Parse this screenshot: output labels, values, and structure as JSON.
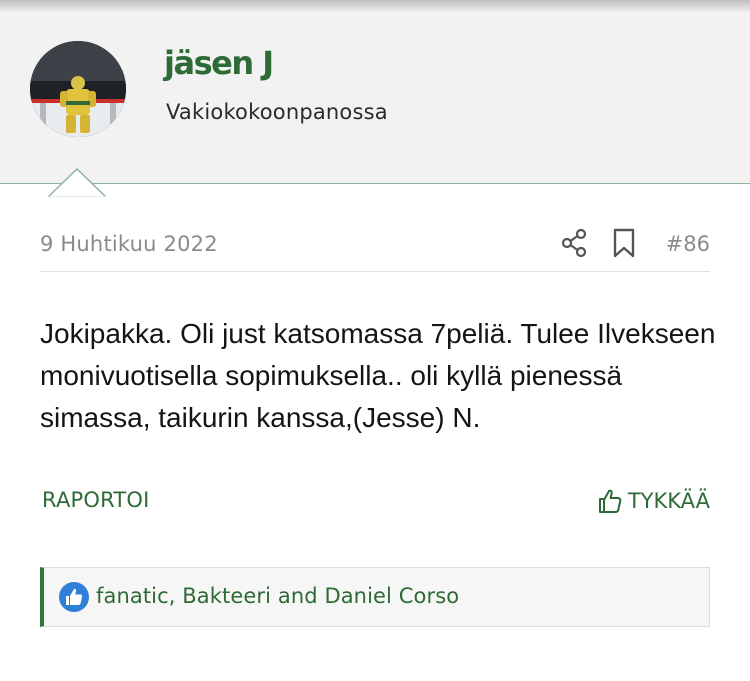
{
  "user": {
    "name": "jäsen J",
    "title": "Vakiokokoonpanossa"
  },
  "post": {
    "date": "9 Huhtikuu 2022",
    "number": "#86",
    "body": "Jokipakka. Oli just katsomassa 7peliä. Tulee Ilvekseen monivuotisella sopimuksella.. oli kyllä pienessä simassa, taikurin kanssa,(Jesse) N."
  },
  "actions": {
    "report": "RAPORTOI",
    "like": "TYKKÄÄ"
  },
  "reactions": {
    "users": "fanatic, Bakteeri and Daniel Corso"
  },
  "colors": {
    "accent": "#2d6a35",
    "reaction_blue": "#2f7fd6",
    "header_bg": "#f2f2f2"
  },
  "icons": [
    "share-icon",
    "bookmark-icon",
    "thumbs-up-icon",
    "like-reaction-icon"
  ]
}
